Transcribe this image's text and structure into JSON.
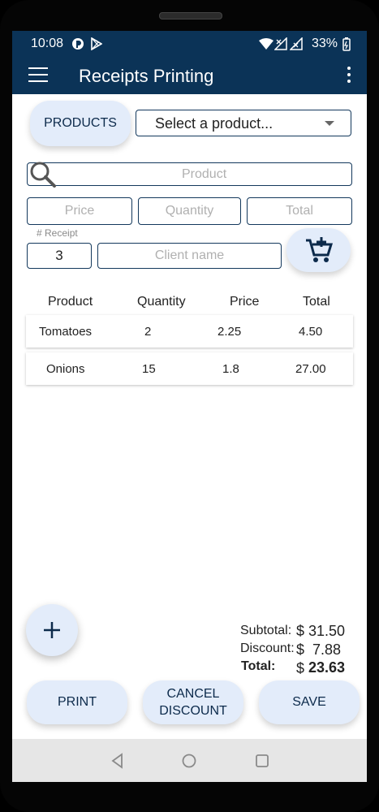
{
  "status": {
    "time": "10:08",
    "battery": "33%"
  },
  "appbar": {
    "title": "Receipts Printing"
  },
  "products_button": "PRODUCTS",
  "product_select": {
    "value": "Select a product..."
  },
  "search": {
    "placeholder": "Product"
  },
  "fields": {
    "price_placeholder": "Price",
    "quantity_placeholder": "Quantity",
    "total_placeholder": "Total",
    "receipt_label": "# Receipt",
    "receipt_value": "3",
    "client_placeholder": "Client name"
  },
  "table": {
    "headers": [
      "Product",
      "Quantity",
      "Price",
      "Total"
    ],
    "rows": [
      [
        "Tomatoes",
        "2",
        "2.25",
        "4.50"
      ],
      [
        "Onions",
        "15",
        "1.8",
        "27.00"
      ]
    ]
  },
  "totals": {
    "subtotal_label": "Subtotal:",
    "subtotal_value": "$ 31.50",
    "discount_label": "Discount:",
    "discount_value": "$  7.88",
    "total_label": "Total:",
    "total_value_prefix": "$",
    "total_value": "23.63"
  },
  "buttons": {
    "print": "PRINT",
    "cancel_line1": "CANCEL",
    "cancel_line2": "DISCOUNT",
    "save": "SAVE"
  },
  "colors": {
    "primary": "#0b3357",
    "button_bg": "#e3ecfa"
  }
}
